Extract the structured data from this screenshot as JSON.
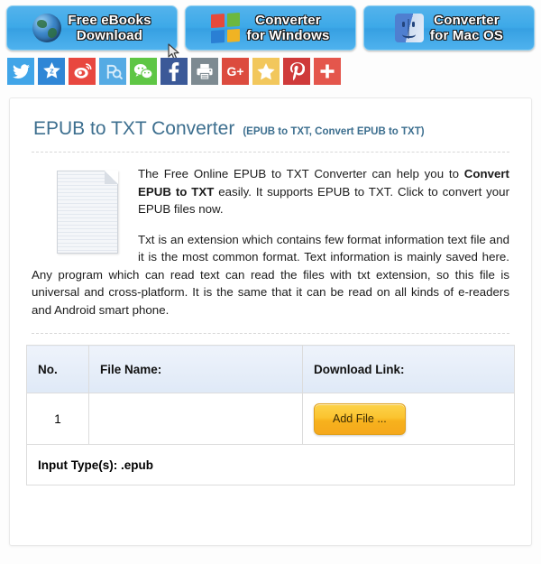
{
  "banners": [
    {
      "icon": "globe-icon",
      "label": "Free eBooks\nDownload",
      "has_cursor": true
    },
    {
      "icon": "windows-logo-icon",
      "label": "Converter\nfor Windows",
      "has_cursor": false
    },
    {
      "icon": "mac-finder-icon",
      "label": "Converter\nfor Mac OS",
      "has_cursor": false
    }
  ],
  "social": [
    {
      "name": "twitter-icon",
      "color": "#41a5e8"
    },
    {
      "name": "zhihu-icon",
      "color": "#2f86d6"
    },
    {
      "name": "weibo-icon",
      "color": "#e8473f"
    },
    {
      "name": "baidu-icon",
      "color": "#55abe4"
    },
    {
      "name": "wechat-icon",
      "color": "#5ec644"
    },
    {
      "name": "facebook-icon",
      "color": "#3b5998"
    },
    {
      "name": "print-icon",
      "color": "#7d8a91"
    },
    {
      "name": "google-plus-icon",
      "color": "#dc4b3e",
      "label": "G+"
    },
    {
      "name": "star-icon",
      "color": "#f2c75c"
    },
    {
      "name": "pinterest-icon",
      "color": "#cf3a3a",
      "label": "P"
    },
    {
      "name": "plus-icon",
      "color": "#e4564c"
    }
  ],
  "page": {
    "title": "EPUB to TXT Converter",
    "subtitle": "(EPUB to TXT, Convert EPUB to TXT)",
    "paragraph1_before": "The Free Online EPUB to TXT Converter can help you to ",
    "paragraph1_bold": "Convert EPUB to TXT",
    "paragraph1_after": " easily. It supports EPUB to TXT. Click to convert your EPUB files now.",
    "paragraph2": "Txt is an extension which contains few format information text file and it is the most common format. Text information is mainly saved here. Any program which can read text can read the files with txt extension, so this file is universal and cross-platform. It is the same that it can be read on all kinds of e-readers and Android smart phone."
  },
  "table": {
    "headers": {
      "no": "No.",
      "file_name": "File Name:",
      "download_link": "Download Link:"
    },
    "rows": [
      {
        "no": "1",
        "file_name": "",
        "button_label": "Add File ..."
      }
    ],
    "footer": "Input Type(s): .epub"
  },
  "colors": {
    "banner_blue": "#3da9e8",
    "title_blue": "#3d6f8f",
    "table_header": "#dfe9f7",
    "add_button": "#fbc430"
  }
}
